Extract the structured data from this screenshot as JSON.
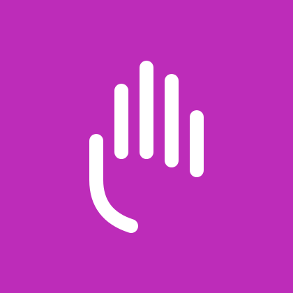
{
  "tile": {
    "background_color": "#BD2CB9",
    "icon_name": "raised-hand-icon",
    "icon_color": "#FFFFFF"
  }
}
